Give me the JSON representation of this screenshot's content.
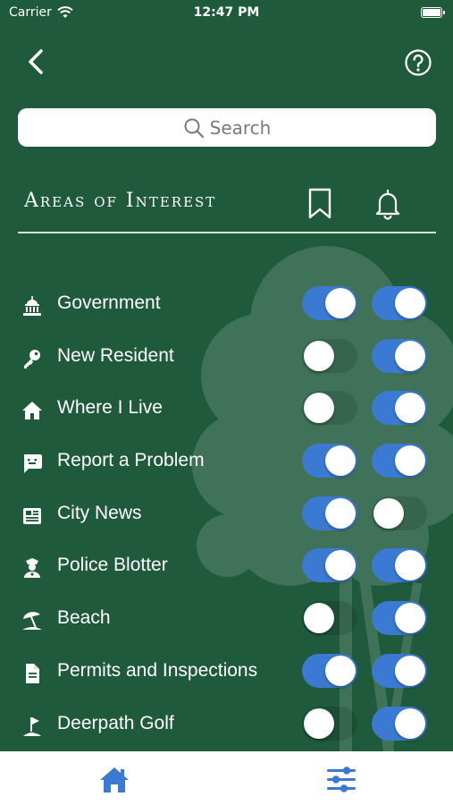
{
  "status_bar": {
    "carrier": "Carrier",
    "time": "12:47 PM"
  },
  "nav": {
    "back_icon": "chevron-left-icon",
    "help_icon": "question-circle-icon"
  },
  "search": {
    "placeholder": "Search"
  },
  "section": {
    "title": "Areas of Interest",
    "bookmark_icon": "bookmark-icon",
    "notify_icon": "bell-icon"
  },
  "colors": {
    "background": "#1f5a3c",
    "toggle_on": "#3a7ad2",
    "tab_active": "#3a7ad2"
  },
  "interests": [
    {
      "label": "Government",
      "icon": "government-building-icon",
      "bookmark": true,
      "notify": true
    },
    {
      "label": "New Resident",
      "icon": "key-icon",
      "bookmark": false,
      "notify": true
    },
    {
      "label": "Where I Live",
      "icon": "house-icon",
      "bookmark": false,
      "notify": true
    },
    {
      "label": "Report a Problem",
      "icon": "chat-alert-icon",
      "bookmark": true,
      "notify": true
    },
    {
      "label": "City News",
      "icon": "newspaper-icon",
      "bookmark": true,
      "notify": false
    },
    {
      "label": "Police Blotter",
      "icon": "police-officer-icon",
      "bookmark": true,
      "notify": true
    },
    {
      "label": "Beach",
      "icon": "beach-umbrella-icon",
      "bookmark": false,
      "notify": true
    },
    {
      "label": "Permits and Inspections",
      "icon": "document-icon",
      "bookmark": true,
      "notify": true
    },
    {
      "label": "Deerpath Golf",
      "icon": "golf-flag-icon",
      "bookmark": false,
      "notify": true
    }
  ],
  "tab_bar": {
    "home_icon": "home-icon",
    "settings_icon": "sliders-icon"
  }
}
